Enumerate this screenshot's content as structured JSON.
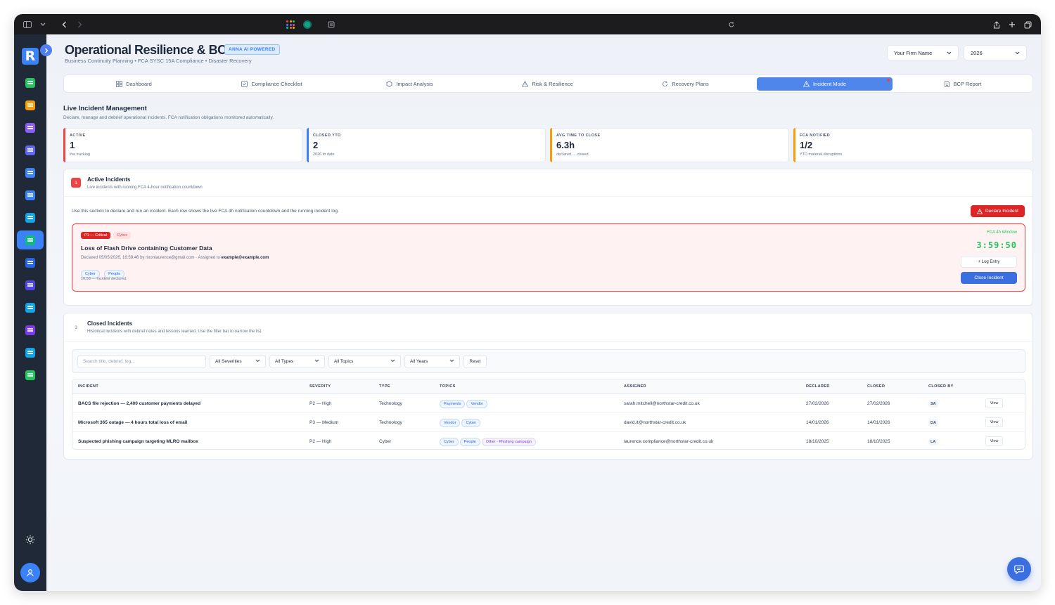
{
  "app": {
    "title": "Operational Resilience & BCP",
    "ai_badge": "ANNA AI POWERED",
    "subtitle": "Business Continuity Planning • FCA SYSC 15A Compliance • Disaster Recovery",
    "logo_letter": "R",
    "firm_select": "Your Firm Name",
    "year_select": "2026"
  },
  "tabs": [
    {
      "label": "Dashboard",
      "icon": "grid-icon"
    },
    {
      "label": "Compliance Checklist",
      "icon": "checkbox-icon"
    },
    {
      "label": "Impact Analysis",
      "icon": "hexagon-icon"
    },
    {
      "label": "Risk & Resilience",
      "icon": "warning-icon"
    },
    {
      "label": "Recovery Plans",
      "icon": "refresh-icon"
    },
    {
      "label": "Incident Mode",
      "icon": "warning-icon"
    },
    {
      "label": "BCP Report",
      "icon": "document-icon"
    }
  ],
  "section": {
    "title": "Live Incident Management",
    "subtitle": "Declare, manage and debrief operational incidents. FCA notification obligations monitored automatically."
  },
  "stats": [
    {
      "label": "ACTIVE",
      "value": "1",
      "note": "live tracking",
      "color": "#ef4444"
    },
    {
      "label": "CLOSED YTD",
      "value": "2",
      "note": "2026 to date",
      "color": "#3b82f6"
    },
    {
      "label": "AVG TIME TO CLOSE",
      "value": "6.3h",
      "note": "declared → closed",
      "color": "#f59e0b"
    },
    {
      "label": "FCA NOTIFIED",
      "value": "1/2",
      "note": "YTD material disruptions",
      "color": "#f59e0b"
    }
  ],
  "active": {
    "badge": "1",
    "title": "Active Incidents",
    "subtitle": "Live incidents with running FCA 4-hour notification countdown",
    "help": "Use this section to declare and run an incident. Each row shows the live FCA 4h notification countdown and the running incident log.",
    "declare_label": "Declare Incident",
    "incident": {
      "severity": "P1 — Critical",
      "type": "Cyber",
      "title": "Loss of Flash Drive containing Customer Data",
      "declared_prefix": "Declared 05/05/2026, 16:58:46 by rixonlaurence@gmail.com · Assigned to ",
      "assigned": "example@example.com",
      "topics": [
        "Cyber",
        "People"
      ],
      "log": "16:58 — Incident declared.",
      "fca_label": "FCA 4h Window",
      "countdown": "3:59:50",
      "log_entry_label": "+ Log Entry",
      "close_label": "Close Incident"
    }
  },
  "closed": {
    "badge": "3",
    "title": "Closed Incidents",
    "subtitle": "Historical incidents with debrief notes and lessons learned. Use the filter bar to narrow the list.",
    "filters": {
      "search_placeholder": "Search title, debrief, log...",
      "severity": "All Severities",
      "type": "All Types",
      "topics": "All Topics",
      "years": "All Years",
      "reset": "Reset"
    },
    "columns": [
      "INCIDENT",
      "SEVERITY",
      "TYPE",
      "TOPICS",
      "ASSIGNED",
      "DECLARED",
      "CLOSED",
      "CLOSED BY"
    ],
    "rows": [
      {
        "incident": "BACS file rejection — 2,400 customer payments delayed",
        "severity": "P2 — High",
        "type": "Technology",
        "topics": [
          "Payments",
          "Vendor"
        ],
        "assigned": "sarah.mitchell@northstar-credit.co.uk",
        "declared": "27/02/2026",
        "closed": "27/02/2026",
        "closed_by": "SA",
        "action": "View"
      },
      {
        "incident": "Microsoft 365 outage — 4 hours total loss of email",
        "severity": "P3 — Medium",
        "type": "Technology",
        "topics": [
          "Vendor",
          "Cyber"
        ],
        "assigned": "david.it@northstar-credit.co.uk",
        "declared": "14/01/2026",
        "closed": "14/01/2026",
        "closed_by": "DA",
        "action": "View"
      },
      {
        "incident": "Suspected phishing campaign targeting MLRO mailbox",
        "severity": "P2 — High",
        "type": "Cyber",
        "topics": [
          "Cyber",
          "People",
          "Other - Phishing campaign"
        ],
        "assigned": "laurence.compliance@northstar-credit.co.uk",
        "declared": "18/10/2025",
        "closed": "18/10/2025",
        "closed_by": "LA",
        "action": "View"
      }
    ]
  },
  "sidebar": {
    "items": [
      {
        "name": "reports-icon",
        "color": "#22c55e"
      },
      {
        "name": "building-icon",
        "color": "#f59e0b"
      },
      {
        "name": "users-icon",
        "color": "#8b5cf6"
      },
      {
        "name": "shield-icon",
        "color": "#6366f1"
      },
      {
        "name": "chart-icon",
        "color": "#3b82f6"
      },
      {
        "name": "news-icon",
        "color": "#3b82f6"
      },
      {
        "name": "monitor-icon",
        "color": "#0ea5e9"
      },
      {
        "name": "shield-check-icon",
        "color": "#10b981"
      },
      {
        "name": "target-icon",
        "color": "#2563eb"
      },
      {
        "name": "store-icon",
        "color": "#4f46e5"
      },
      {
        "name": "shield-lock-icon",
        "color": "#0ea5e9"
      },
      {
        "name": "list-icon",
        "color": "#7c3aed"
      },
      {
        "name": "map-icon",
        "color": "#0ea5e9"
      },
      {
        "name": "card-icon",
        "color": "#22c55e"
      }
    ]
  }
}
